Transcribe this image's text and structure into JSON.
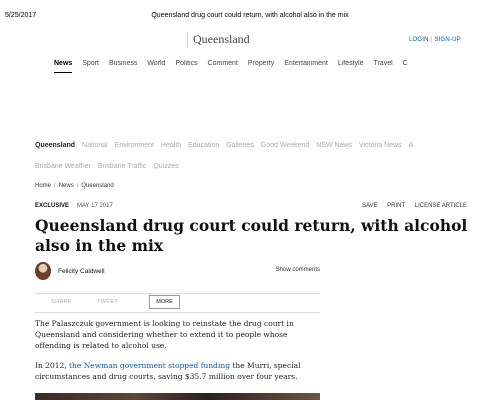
{
  "print": {
    "date": "5/25/2017",
    "title": "Queensland drug court could return, with alcohol also in the mix"
  },
  "masthead": {
    "section_title": "Queensland",
    "login": "LOGIN",
    "signup": "SIGN-UP"
  },
  "main_nav": {
    "items": [
      "News",
      "Sport",
      "Business",
      "World",
      "Politics",
      "Comment",
      "Property",
      "Entertainment",
      "Lifestyle",
      "Travel",
      "C"
    ],
    "active_index": 0
  },
  "sub_nav": {
    "row1": [
      "Queensland",
      "National",
      "Environment",
      "Health",
      "Education",
      "Galleries",
      "Good Weekend",
      "NSW News",
      "Victoria News",
      "A"
    ],
    "row2": [
      "Brisbane Weather",
      "Brisbane Traffic",
      "Quizzes"
    ],
    "active_index": 0
  },
  "breadcrumb": [
    "Home",
    "News",
    "Queensland"
  ],
  "meta": {
    "label": "EXCLUSIVE",
    "date": "MAY 17 2017",
    "save": "SAVE",
    "print": "PRINT",
    "license": "LICENSE ARTICLE"
  },
  "article": {
    "headline": "Queensland drug court could return, with alcohol also in the mix",
    "author": "Felicity Caldwell",
    "comments": "Show comments",
    "share": "SHARE",
    "tweet": "TWEET",
    "more": "MORE",
    "p1": "The Palaszczuk government is looking to reinstate the drug court in Queensland and considering whether to extend it to people whose offending is related to alcohol use.",
    "p2_prefix": "In 2012,",
    "p2_link": "the Newman government stopped funding",
    "p2_suffix": "the Murri, special circumstances and drug courts, saving $35.7 million over four years."
  }
}
